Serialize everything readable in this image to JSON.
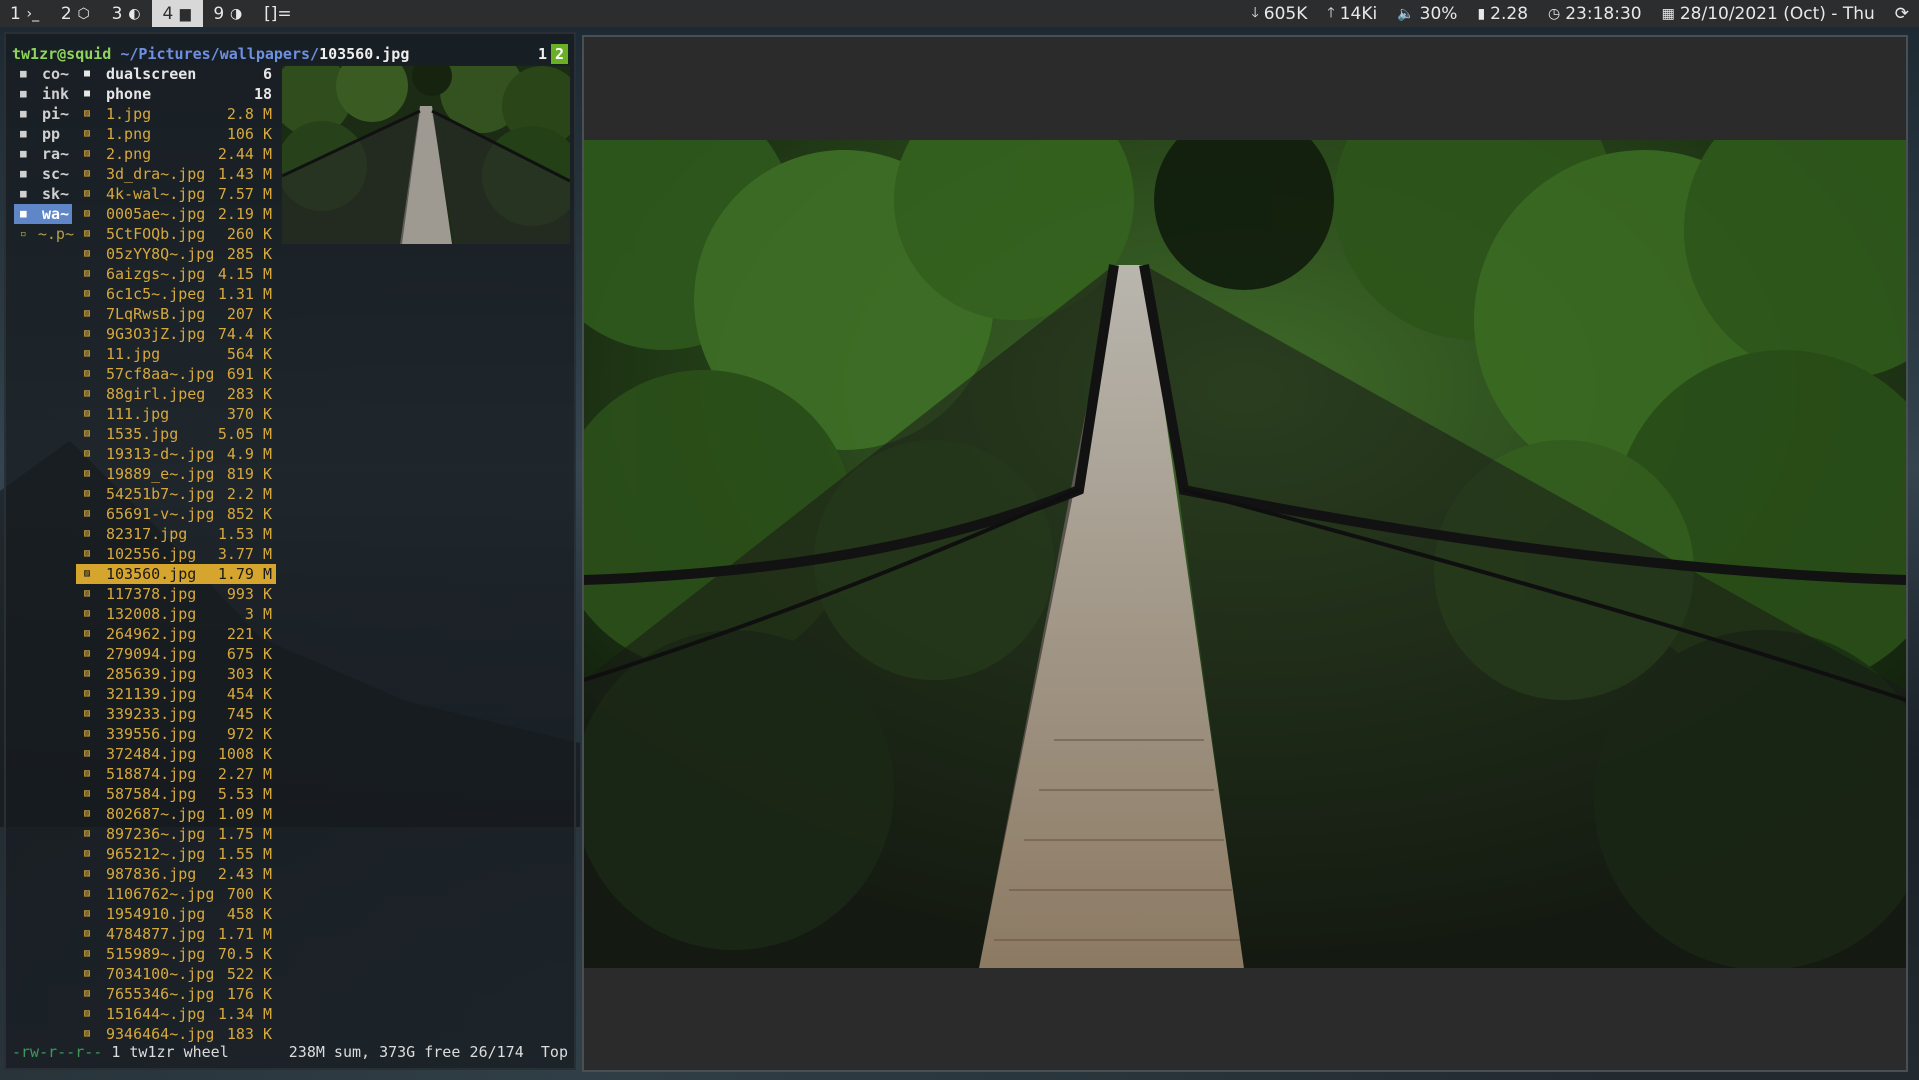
{
  "topbar": {
    "workspaces": [
      {
        "num": "1",
        "icon": "terminal-icon",
        "glyph": "›_",
        "active": false
      },
      {
        "num": "2",
        "icon": "cube-icon",
        "glyph": "⬡",
        "active": false
      },
      {
        "num": "3",
        "icon": "moon-icon",
        "glyph": "◐",
        "active": false
      },
      {
        "num": "4",
        "icon": "folder-icon",
        "glyph": "▆",
        "active": true
      },
      {
        "num": "9",
        "icon": "toggle-icon",
        "glyph": "◑",
        "active": false
      }
    ],
    "layout": "[]=",
    "download": "605K",
    "upload": "14Ki",
    "volume": "30%",
    "battery": "2.28",
    "time": "23:18:30",
    "date": "28/10/2021 (Oct) - Thu"
  },
  "terminal": {
    "user": "tw1zr@squid",
    "path": "~/Pictures/wallpapers/",
    "file": "103560.jpg",
    "tab1": "1",
    "tab2": "2",
    "parent_dirs": [
      {
        "label": "co~",
        "selected": false
      },
      {
        "label": "ink",
        "selected": false
      },
      {
        "label": "pi~",
        "selected": false
      },
      {
        "label": "pp",
        "selected": false
      },
      {
        "label": "ra~",
        "selected": false
      },
      {
        "label": "sc~",
        "selected": false
      },
      {
        "label": "sk~",
        "selected": false
      },
      {
        "label": "wa~",
        "selected": true
      },
      {
        "label": "~.p~",
        "selected": false
      }
    ],
    "entries": [
      {
        "name": "dualscreen",
        "size": "6",
        "type": "dir"
      },
      {
        "name": "phone",
        "size": "18",
        "type": "dir"
      },
      {
        "name": "1.jpg",
        "size": "2.8 M",
        "type": "file"
      },
      {
        "name": "1.png",
        "size": "106 K",
        "type": "file"
      },
      {
        "name": "2.png",
        "size": "2.44 M",
        "type": "file"
      },
      {
        "name": "3d_dra~.jpg",
        "size": "1.43 M",
        "type": "file"
      },
      {
        "name": "4k-wal~.jpg",
        "size": "7.57 M",
        "type": "file"
      },
      {
        "name": "0005ae~.jpg",
        "size": "2.19 M",
        "type": "file"
      },
      {
        "name": "5CtFOQb.jpg",
        "size": "260 K",
        "type": "file"
      },
      {
        "name": "05zYY8Q~.jpg",
        "size": "285 K",
        "type": "file"
      },
      {
        "name": "6aizgs~.jpg",
        "size": "4.15 M",
        "type": "file"
      },
      {
        "name": "6c1c5~.jpeg",
        "size": "1.31 M",
        "type": "file"
      },
      {
        "name": "7LqRwsB.jpg",
        "size": "207 K",
        "type": "file"
      },
      {
        "name": "9G3O3jZ.jpg",
        "size": "74.4 K",
        "type": "file"
      },
      {
        "name": "11.jpg",
        "size": "564 K",
        "type": "file"
      },
      {
        "name": "57cf8aa~.jpg",
        "size": "691 K",
        "type": "file"
      },
      {
        "name": "88girl.jpeg",
        "size": "283 K",
        "type": "file"
      },
      {
        "name": "111.jpg",
        "size": "370 K",
        "type": "file"
      },
      {
        "name": "1535.jpg",
        "size": "5.05 M",
        "type": "file"
      },
      {
        "name": "19313-d~.jpg",
        "size": "4.9 M",
        "type": "file"
      },
      {
        "name": "19889_e~.jpg",
        "size": "819 K",
        "type": "file"
      },
      {
        "name": "54251b7~.jpg",
        "size": "2.2 M",
        "type": "file"
      },
      {
        "name": "65691-v~.jpg",
        "size": "852 K",
        "type": "file"
      },
      {
        "name": "82317.jpg",
        "size": "1.53 M",
        "type": "file"
      },
      {
        "name": "102556.jpg",
        "size": "3.77 M",
        "type": "file"
      },
      {
        "name": "103560.jpg",
        "size": "1.79 M",
        "type": "file",
        "selected": true
      },
      {
        "name": "117378.jpg",
        "size": "993 K",
        "type": "file"
      },
      {
        "name": "132008.jpg",
        "size": "3 M",
        "type": "file"
      },
      {
        "name": "264962.jpg",
        "size": "221 K",
        "type": "file"
      },
      {
        "name": "279094.jpg",
        "size": "675 K",
        "type": "file"
      },
      {
        "name": "285639.jpg",
        "size": "303 K",
        "type": "file"
      },
      {
        "name": "321139.jpg",
        "size": "454 K",
        "type": "file"
      },
      {
        "name": "339233.jpg",
        "size": "745 K",
        "type": "file"
      },
      {
        "name": "339556.jpg",
        "size": "972 K",
        "type": "file"
      },
      {
        "name": "372484.jpg",
        "size": "1008 K",
        "type": "file"
      },
      {
        "name": "518874.jpg",
        "size": "2.27 M",
        "type": "file"
      },
      {
        "name": "587584.jpg",
        "size": "5.53 M",
        "type": "file"
      },
      {
        "name": "802687~.jpg",
        "size": "1.09 M",
        "type": "file"
      },
      {
        "name": "897236~.jpg",
        "size": "1.75 M",
        "type": "file"
      },
      {
        "name": "965212~.jpg",
        "size": "1.55 M",
        "type": "file"
      },
      {
        "name": "987836.jpg",
        "size": "2.43 M",
        "type": "file"
      },
      {
        "name": "1106762~.jpg",
        "size": "700 K",
        "type": "file"
      },
      {
        "name": "1954910.jpg",
        "size": "458 K",
        "type": "file"
      },
      {
        "name": "4784877.jpg",
        "size": "1.71 M",
        "type": "file"
      },
      {
        "name": "515989~.jpg",
        "size": "70.5 K",
        "type": "file"
      },
      {
        "name": "7034100~.jpg",
        "size": "522 K",
        "type": "file"
      },
      {
        "name": "7655346~.jpg",
        "size": "176 K",
        "type": "file"
      },
      {
        "name": "151644~.jpg",
        "size": "1.34 M",
        "type": "file"
      },
      {
        "name": "9346464~.jpg",
        "size": "183 K",
        "type": "file"
      }
    ],
    "footer": {
      "perms": "-rw-r--r--",
      "owner": " 1 tw1zr wheel",
      "summary": "238M sum, 373G free",
      "position": "26/174",
      "scroll": "Top"
    }
  },
  "colors": {
    "accent_green": "#6ab023",
    "selection_yellow": "#d6a52d",
    "selection_blue": "#5f86c7",
    "file_orange": "#d7a93d"
  }
}
